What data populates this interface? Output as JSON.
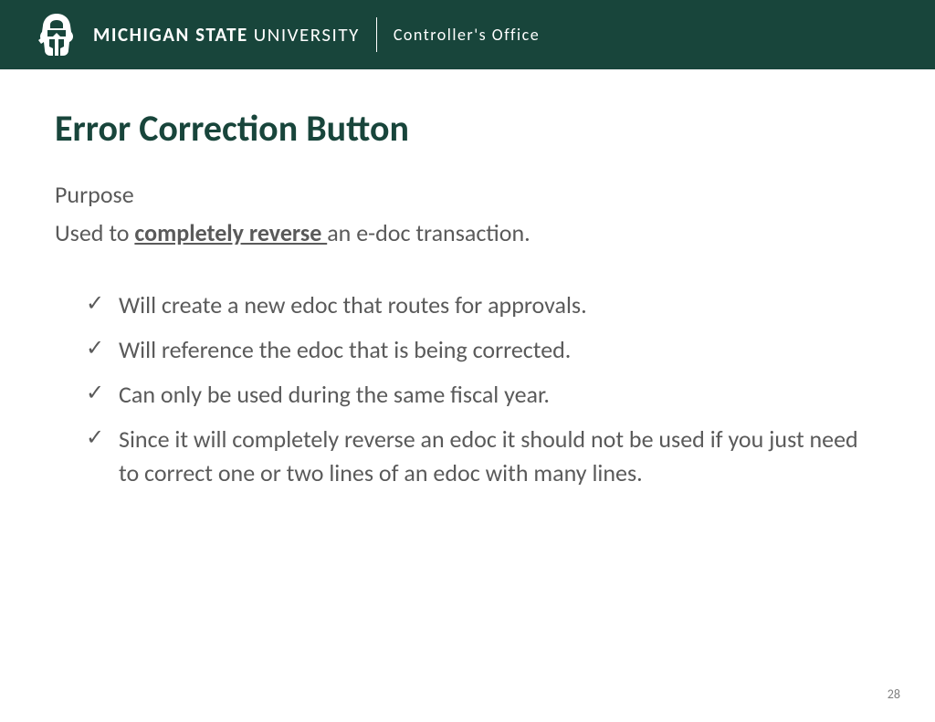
{
  "header": {
    "brand_bold": "MICHIGAN STATE",
    "brand_light": "UNIVERSITY",
    "office": "Controller's Office"
  },
  "slide": {
    "title": "Error Correction Button",
    "purpose_label": "Purpose",
    "usage_prefix": "Used to ",
    "usage_emphasis": "completely reverse ",
    "usage_suffix": "an e-doc transaction.",
    "bullets": [
      "Will create a new edoc that routes for approvals.",
      "Will reference the edoc that is being corrected.",
      "Can only be used during the same fiscal year.",
      "Since it will completely reverse an edoc it should not be used if you just need to correct one or two lines of an edoc with many lines."
    ],
    "page_number": "28"
  }
}
